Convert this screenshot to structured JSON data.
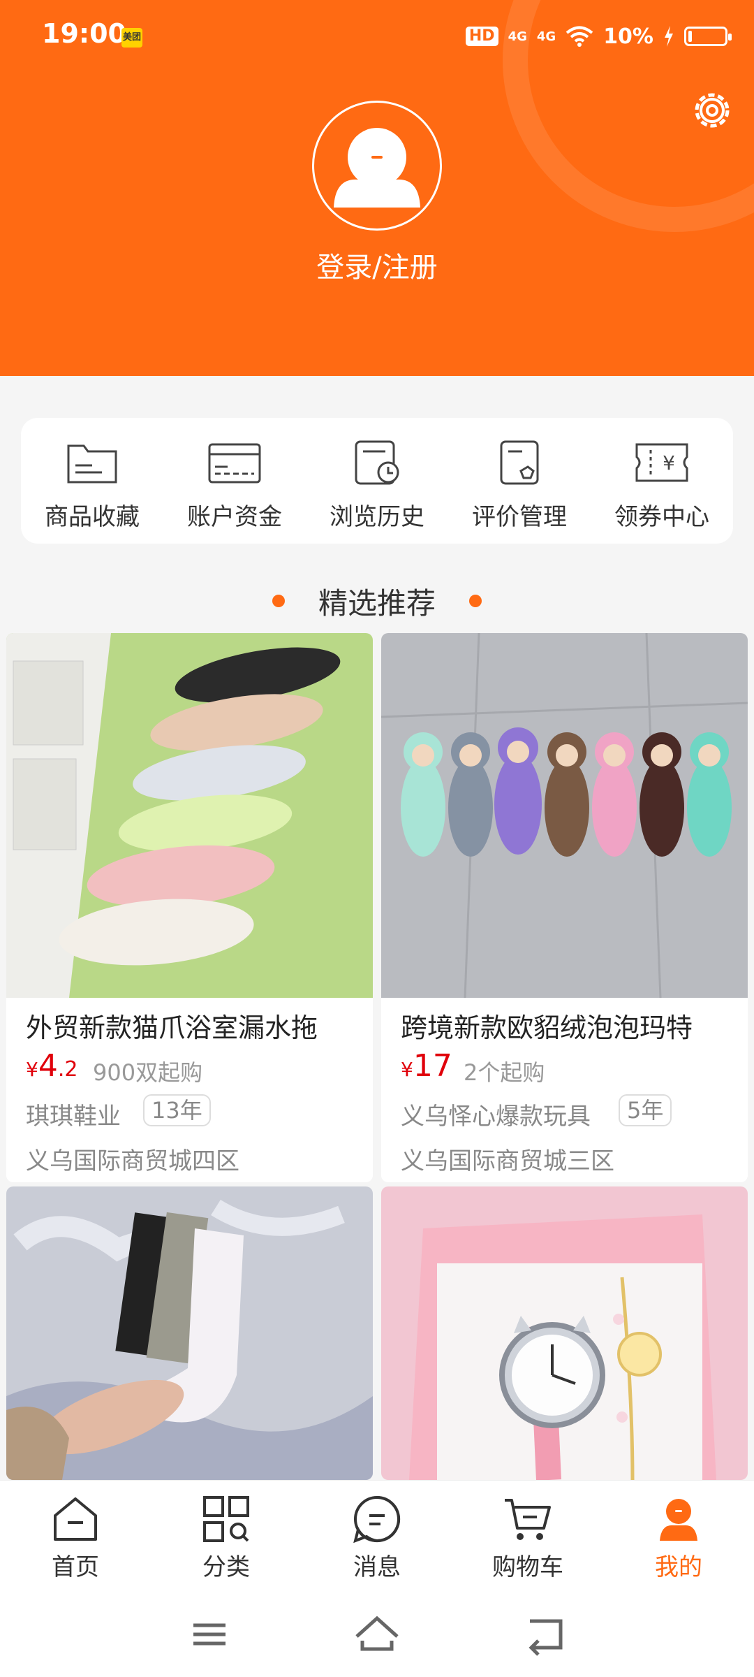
{
  "status_bar": {
    "time": "19:00",
    "app_badge": "美团",
    "hd": "HD",
    "net1": "4G",
    "net2": "4G",
    "battery": "10%"
  },
  "header": {
    "login_label": "登录/注册",
    "settings_icon": "gear-icon",
    "avatar_icon": "user-avatar-icon",
    "bg_color": "#ff6a13"
  },
  "quick_actions": [
    {
      "label": "商品收藏",
      "icon": "folder-icon"
    },
    {
      "label": "账户资金",
      "icon": "card-icon"
    },
    {
      "label": "浏览历史",
      "icon": "history-icon"
    },
    {
      "label": "评价管理",
      "icon": "review-icon"
    },
    {
      "label": "领券中心",
      "icon": "coupon-icon"
    }
  ],
  "recommend": {
    "title": "精选推荐"
  },
  "products": [
    {
      "name": "外贸新款猫爪浴室漏水拖",
      "currency": "¥",
      "price_int": "4",
      "price_dec": ".2",
      "moq": "900双起购",
      "shop": "琪琪鞋业",
      "years": "13年",
      "mall": "义乌国际商贸城四区",
      "image": "slippers-photo"
    },
    {
      "name": "跨境新款欧貂绒泡泡玛特",
      "currency": "¥",
      "price_int": "17",
      "price_dec": "",
      "moq": "2个起购",
      "shop": "义乌怿心爆款玩具",
      "years": "5年",
      "mall": "义乌国际商贸城三区",
      "image": "plush-toys-photo"
    },
    {
      "image": "socks-photo"
    },
    {
      "image": "watch-gift-box-photo"
    }
  ],
  "tabbar": [
    {
      "label": "首页",
      "icon": "home-icon"
    },
    {
      "label": "分类",
      "icon": "category-icon"
    },
    {
      "label": "消息",
      "icon": "message-icon"
    },
    {
      "label": "购物车",
      "icon": "cart-icon"
    },
    {
      "label": "我的",
      "icon": "profile-icon",
      "active": true
    }
  ],
  "accent_color": "#ff6a13",
  "price_color": "#e0000a"
}
